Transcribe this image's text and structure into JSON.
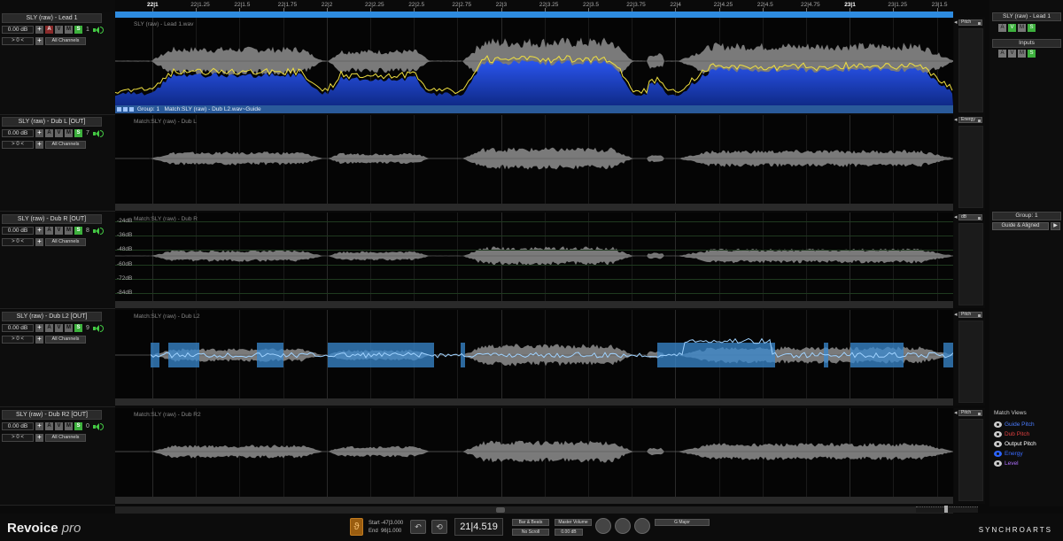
{
  "app": {
    "name": "Revoice",
    "name_suffix": "pro",
    "vendor": "SYNCHROARTS"
  },
  "ruler": {
    "ticks": [
      {
        "label": "22|1",
        "major": true
      },
      {
        "label": "22|1.25"
      },
      {
        "label": "22|1.5"
      },
      {
        "label": "22|1.75"
      },
      {
        "label": "22|2"
      },
      {
        "label": "22|2.25"
      },
      {
        "label": "22|2.5"
      },
      {
        "label": "22|2.75"
      },
      {
        "label": "22|3"
      },
      {
        "label": "22|3.25"
      },
      {
        "label": "22|3.5"
      },
      {
        "label": "22|3.75"
      },
      {
        "label": "22|4"
      },
      {
        "label": "22|4.25"
      },
      {
        "label": "22|4.5"
      },
      {
        "label": "22|4.75"
      },
      {
        "label": "23|1",
        "major": true
      },
      {
        "label": "23|1.25"
      },
      {
        "label": "23|1.5"
      }
    ]
  },
  "tracks": [
    {
      "name": "SLY (raw) - Lead 1",
      "gain": "0.00 dB",
      "nav": "> 0 <",
      "channels": "All Channels",
      "num": "1",
      "view": "Pitch",
      "lane_title": "SLY (raw) - Lead 1.wav",
      "armed": true
    },
    {
      "name": "SLY (raw) - Dub L [OUT]",
      "gain": "0.00 dB",
      "nav": "> 0 <",
      "channels": "All Channels",
      "num": "7",
      "view": "Energy",
      "lane_title": "Match:SLY (raw) - Dub L"
    },
    {
      "name": "SLY (raw) - Dub R [OUT]",
      "gain": "0.00 dB",
      "nav": "> 0 <",
      "channels": "All Channels",
      "num": "8",
      "view": "dB",
      "lane_title": "Match:SLY (raw) - Dub R"
    },
    {
      "name": "SLY (raw) - Dub L2 [OUT]",
      "gain": "0.00 dB",
      "nav": "> 0 <",
      "channels": "All Channels",
      "num": "9",
      "view": "Pitch",
      "lane_title": "Match:SLY (raw) - Dub L2"
    },
    {
      "name": "SLY (raw) - Dub R2 [OUT]",
      "gain": "0.00 dB",
      "nav": "> 0 <",
      "channels": "All Channels",
      "num": "0",
      "view": "Pitch",
      "lane_title": "Match:SLY (raw) - Dub R2"
    }
  ],
  "track_buttons": {
    "a": "A",
    "v": "V",
    "m": "M",
    "s": "S",
    "plus": "+"
  },
  "db_scale": [
    "-24dB",
    "-36dB",
    "-48dB",
    "-60dB",
    "-72dB",
    "-84dB"
  ],
  "group_bar": {
    "label": "Group: 1",
    "match": "Match:SLY (raw) - Dub L2.wav~Guide"
  },
  "right_panel": {
    "selected_track": "SLY (raw) - Lead 1",
    "inputs_label": "Inputs",
    "group_title": "Group: 1",
    "group_mode": "Guide & Aligned",
    "match_views_title": "Match Views",
    "match_views": [
      {
        "label": "Guide Pitch",
        "color": "#4a7cff",
        "eye": "white"
      },
      {
        "label": "Dub Pitch",
        "color": "#e04040",
        "eye": "white"
      },
      {
        "label": "Output Pitch",
        "color": "#ffffff",
        "eye": "white"
      },
      {
        "label": "Energy",
        "color": "#3a6bff",
        "eye": "blue"
      },
      {
        "label": "Level",
        "color": "#b070ff",
        "eye": "white"
      }
    ]
  },
  "transport": {
    "start_label": "Start",
    "start_value": "-47|3.000",
    "end_label": "End",
    "end_value": "96|1.000",
    "position": "21|4.519",
    "time_format": "Bar & Beats",
    "scroll_mode": "No Scroll",
    "master_volume_label": "Master Volume",
    "master_volume": "0.00 dB",
    "key": "G Major"
  },
  "colors": {
    "loop": "#2e8be0",
    "energy": "#1e44cc",
    "pitch_blue": "#4aa0e8",
    "guide": "#f0e040",
    "accent_green": "#3db13d"
  }
}
